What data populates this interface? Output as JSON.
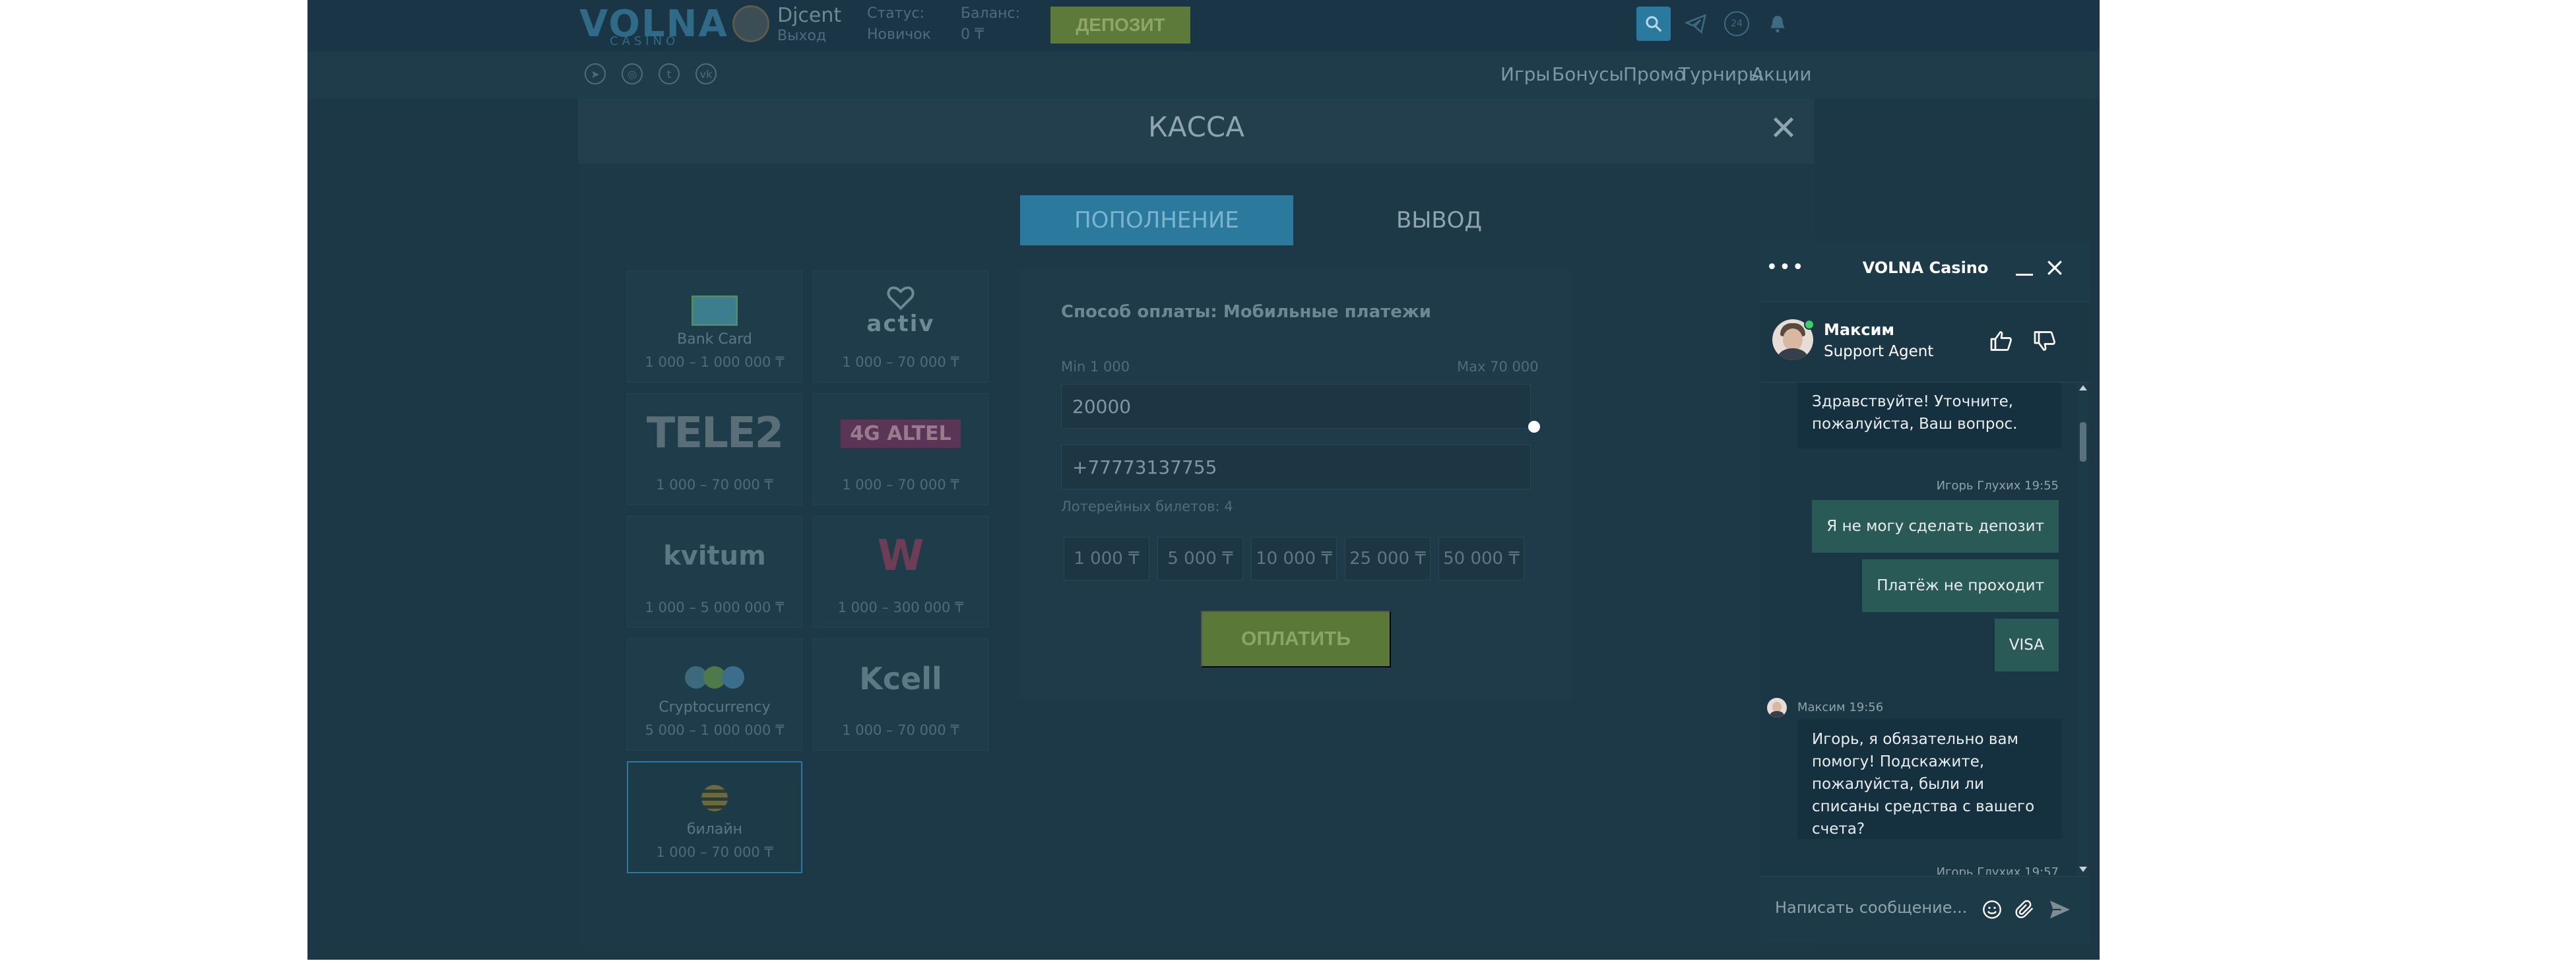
{
  "header": {
    "logo": "VOLNA",
    "logo_sub": "CASINO",
    "username": "Djcent",
    "logout": "Выход",
    "status_label": "Статус:",
    "status_value": "Новичок",
    "balance_label": "Баланс:",
    "balance_value": "0 ₸",
    "deposit_button": "ДЕПОЗИТ",
    "badge_24": "24"
  },
  "nav": {
    "items": [
      "Игры",
      "Бонусы",
      "Промо",
      "Турниры",
      "Акции"
    ],
    "social": [
      "telegram-icon",
      "instagram-icon",
      "twitter-icon",
      "vk-icon"
    ]
  },
  "modal": {
    "title": "КАССА",
    "tab_deposit": "ПОПОЛНЕНИЕ",
    "tab_withdraw": "ВЫВОД",
    "methods": [
      {
        "name": "Bank Card",
        "range": "1 000 – 1 000 000 ₸"
      },
      {
        "name": "",
        "range": "1 000 – 70 000 ₸",
        "logo": "activ"
      },
      {
        "name": "",
        "range": "1 000 – 70 000 ₸",
        "logo": "TELE2"
      },
      {
        "name": "",
        "range": "1 000 – 70 000 ₸",
        "logo": "4G ALTEL"
      },
      {
        "name": "",
        "range": "1 000 – 5 000 000 ₸",
        "logo": "kvitum"
      },
      {
        "name": "",
        "range": "1 000 – 300 000 ₸",
        "logo": "W"
      },
      {
        "name": "Cryptocurrency",
        "range": "5 000 – 1 000 000 ₸"
      },
      {
        "name": "",
        "range": "1 000 – 70 000 ₸",
        "logo": "Kcell"
      },
      {
        "name": "билайн",
        "range": "1 000 – 70 000 ₸"
      }
    ],
    "payment_title": "Способ оплаты: Мобильные платежи",
    "min": "Min 1 000",
    "max": "Max 70 000",
    "amount": "20000",
    "phone": "+77773137755",
    "tickets": "Лотерейных билетов: 4",
    "chips": [
      "1 000 ₸",
      "5 000 ₸",
      "10 000 ₸",
      "25 000 ₸",
      "50 000 ₸"
    ],
    "pay_button": "ОПЛАТИТЬ"
  },
  "chat": {
    "title": "VOLNA Casino",
    "agent_name": "Максим",
    "agent_role": "Support Agent",
    "messages": {
      "m1": "Здравствуйте! Уточните, пожалуйста, Ваш вопрос.",
      "meta1": "Игорь Глухих 19:55",
      "m2": "Я не могу сделать депозит",
      "m3": "Платёж не проходит",
      "m4": "VISA",
      "meta2": "Максим 19:56",
      "m5": "Игорь, я обязательно вам помогу! Подскажите, пожалуйста, были ли списаны средства с вашего счета?",
      "meta3": "Игорь Глухих 19:57"
    },
    "input_placeholder": "Написать сообщение..."
  },
  "colors": {
    "accent": "#2a7aa0",
    "deposit": "#5d7a3a",
    "chat_bubble_out": "#2a5a55",
    "online": "#3ecf6a"
  }
}
